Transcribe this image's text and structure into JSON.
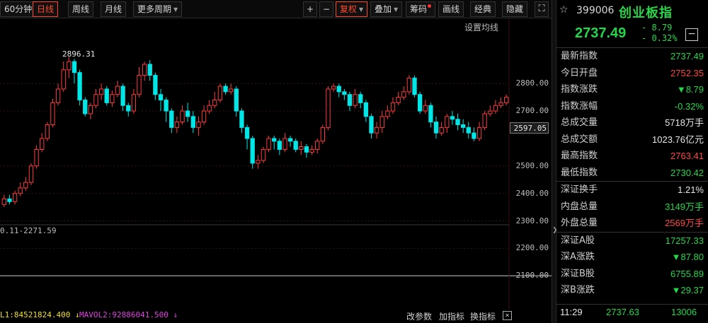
{
  "toolbar": {
    "items": [
      {
        "label": "60分钟",
        "active": false
      },
      {
        "label": "日线",
        "active": true
      },
      {
        "label": "周线",
        "active": false
      },
      {
        "label": "月线",
        "active": false
      },
      {
        "label": "更多周期",
        "active": false
      }
    ],
    "zoom_in": "+",
    "zoom_out": "−",
    "fuquan": "复权",
    "diejia": "叠加",
    "chouma": "筹码",
    "huaxian": "画线",
    "jingdian": "经典",
    "yincang": "隐藏",
    "fullscreen": "⛶"
  },
  "chart": {
    "set_ma_label": "设置均线",
    "price_ticks": [
      {
        "value": "2800.00",
        "y": 2800
      },
      {
        "value": "2700.00",
        "y": 2700
      },
      {
        "value": "2500.00",
        "y": 2500
      },
      {
        "value": "2400.00",
        "y": 2400
      },
      {
        "value": "2300.00",
        "y": 2300
      },
      {
        "value": "2200.00",
        "y": 2200
      },
      {
        "value": "2100.00",
        "y": 2100
      }
    ],
    "current_tag": "2597.05",
    "high_marker": "2896.31",
    "low_marker": "0.11-2271.59",
    "vol1": "L1:84521824.400 ↓",
    "vol2": "MAVOL2:92886041.500 ↓",
    "vol_buttons": [
      "改参数",
      "加指标",
      "换指标"
    ],
    "vol_close": "×",
    "colors": {
      "up": "#ff3b3b",
      "down": "#00e5e5",
      "grid": "#3a1010"
    }
  },
  "chart_data": {
    "type": "candlestick",
    "ylim": [
      2080,
      2960
    ],
    "candles": [
      [
        2360,
        2380,
        2395,
        2350
      ],
      [
        2380,
        2370,
        2395,
        2360
      ],
      [
        2370,
        2400,
        2410,
        2360
      ],
      [
        2400,
        2420,
        2440,
        2390
      ],
      [
        2420,
        2440,
        2460,
        2410
      ],
      [
        2440,
        2500,
        2510,
        2430
      ],
      [
        2500,
        2560,
        2575,
        2490
      ],
      [
        2560,
        2600,
        2620,
        2550
      ],
      [
        2600,
        2650,
        2660,
        2590
      ],
      [
        2650,
        2730,
        2745,
        2640
      ],
      [
        2730,
        2780,
        2800,
        2720
      ],
      [
        2780,
        2850,
        2880,
        2770
      ],
      [
        2850,
        2880,
        2896,
        2820
      ],
      [
        2880,
        2840,
        2890,
        2800
      ],
      [
        2840,
        2740,
        2850,
        2720
      ],
      [
        2740,
        2690,
        2750,
        2680
      ],
      [
        2690,
        2720,
        2730,
        2670
      ],
      [
        2720,
        2760,
        2780,
        2710
      ],
      [
        2760,
        2780,
        2800,
        2740
      ],
      [
        2780,
        2730,
        2790,
        2720
      ],
      [
        2730,
        2760,
        2775,
        2715
      ],
      [
        2760,
        2790,
        2810,
        2750
      ],
      [
        2790,
        2720,
        2800,
        2700
      ],
      [
        2720,
        2700,
        2730,
        2680
      ],
      [
        2700,
        2760,
        2780,
        2690
      ],
      [
        2760,
        2830,
        2860,
        2750
      ],
      [
        2830,
        2870,
        2880,
        2810
      ],
      [
        2870,
        2830,
        2885,
        2810
      ],
      [
        2830,
        2760,
        2840,
        2740
      ],
      [
        2760,
        2740,
        2780,
        2700
      ],
      [
        2740,
        2700,
        2750,
        2660
      ],
      [
        2700,
        2640,
        2710,
        2620
      ],
      [
        2640,
        2660,
        2680,
        2620
      ],
      [
        2660,
        2700,
        2720,
        2650
      ],
      [
        2700,
        2680,
        2730,
        2660
      ],
      [
        2680,
        2640,
        2700,
        2620
      ],
      [
        2640,
        2660,
        2680,
        2610
      ],
      [
        2660,
        2700,
        2720,
        2650
      ],
      [
        2700,
        2720,
        2740,
        2690
      ],
      [
        2720,
        2740,
        2770,
        2710
      ],
      [
        2740,
        2790,
        2800,
        2730
      ],
      [
        2790,
        2770,
        2800,
        2760
      ],
      [
        2770,
        2780,
        2800,
        2760
      ],
      [
        2780,
        2700,
        2790,
        2680
      ],
      [
        2700,
        2640,
        2710,
        2620
      ],
      [
        2640,
        2600,
        2650,
        2560
      ],
      [
        2600,
        2510,
        2610,
        2490
      ],
      [
        2510,
        2520,
        2540,
        2490
      ],
      [
        2520,
        2560,
        2570,
        2510
      ],
      [
        2560,
        2600,
        2610,
        2550
      ],
      [
        2600,
        2590,
        2610,
        2560
      ],
      [
        2590,
        2560,
        2600,
        2540
      ],
      [
        2560,
        2600,
        2620,
        2550
      ],
      [
        2600,
        2590,
        2610,
        2570
      ],
      [
        2590,
        2560,
        2600,
        2550
      ],
      [
        2560,
        2570,
        2590,
        2540
      ],
      [
        2570,
        2550,
        2580,
        2530
      ],
      [
        2550,
        2560,
        2575,
        2540
      ],
      [
        2560,
        2590,
        2600,
        2545
      ],
      [
        2590,
        2640,
        2650,
        2580
      ],
      [
        2640,
        2780,
        2790,
        2630
      ],
      [
        2780,
        2790,
        2800,
        2770
      ],
      [
        2790,
        2770,
        2800,
        2750
      ],
      [
        2770,
        2760,
        2780,
        2740
      ],
      [
        2760,
        2720,
        2770,
        2700
      ],
      [
        2720,
        2760,
        2780,
        2710
      ],
      [
        2760,
        2730,
        2770,
        2710
      ],
      [
        2730,
        2680,
        2740,
        2660
      ],
      [
        2680,
        2620,
        2690,
        2600
      ],
      [
        2620,
        2640,
        2660,
        2600
      ],
      [
        2640,
        2680,
        2700,
        2620
      ],
      [
        2680,
        2700,
        2720,
        2670
      ],
      [
        2700,
        2730,
        2750,
        2690
      ],
      [
        2730,
        2750,
        2770,
        2720
      ],
      [
        2750,
        2770,
        2790,
        2740
      ],
      [
        2770,
        2820,
        2830,
        2760
      ],
      [
        2820,
        2760,
        2830,
        2750
      ],
      [
        2760,
        2700,
        2770,
        2690
      ],
      [
        2700,
        2720,
        2740,
        2690
      ],
      [
        2720,
        2660,
        2730,
        2640
      ],
      [
        2660,
        2620,
        2680,
        2600
      ],
      [
        2620,
        2640,
        2660,
        2610
      ],
      [
        2640,
        2680,
        2690,
        2620
      ],
      [
        2680,
        2670,
        2700,
        2650
      ],
      [
        2670,
        2650,
        2690,
        2630
      ],
      [
        2650,
        2640,
        2670,
        2620
      ],
      [
        2640,
        2620,
        2660,
        2600
      ],
      [
        2620,
        2600,
        2640,
        2590
      ],
      [
        2600,
        2640,
        2660,
        2590
      ],
      [
        2640,
        2690,
        2700,
        2630
      ],
      [
        2690,
        2700,
        2720,
        2680
      ],
      [
        2700,
        2720,
        2740,
        2690
      ],
      [
        2720,
        2730,
        2750,
        2710
      ],
      [
        2730,
        2750,
        2760,
        2720
      ]
    ]
  },
  "panel": {
    "star": "☆",
    "code": "399006",
    "name": "创业板指",
    "price": "2737.49",
    "change": "- 8.79",
    "change_pct": "- 0.32%",
    "minimize": "−",
    "rows_a": [
      {
        "k": "最新指数",
        "v": "2737.49",
        "cls": "down"
      },
      {
        "k": "今日开盘",
        "v": "2752.35",
        "cls": "up"
      },
      {
        "k": "指数涨跌",
        "v": "▼8.79",
        "cls": "down"
      },
      {
        "k": "指数涨幅",
        "v": "-0.32%",
        "cls": "down"
      },
      {
        "k": "总成交量",
        "v": "5718万手",
        "cls": "white"
      },
      {
        "k": "总成交额",
        "v": "1023.76亿元",
        "cls": "white"
      },
      {
        "k": "最高指数",
        "v": "2763.41",
        "cls": "up"
      },
      {
        "k": "最低指数",
        "v": "2730.42",
        "cls": "down"
      }
    ],
    "rows_b": [
      {
        "k": "深证换手",
        "v": "1.21%",
        "cls": "white"
      },
      {
        "k": "内盘总量",
        "v": "3149万手",
        "cls": "down"
      },
      {
        "k": "外盘总量",
        "v": "2569万手",
        "cls": "up"
      }
    ],
    "rows_c": [
      {
        "k": "深证A股",
        "v": "17257.33",
        "cls": "down"
      },
      {
        "k": "深A涨跌",
        "v": "▼87.80",
        "cls": "down"
      },
      {
        "k": "深证B股",
        "v": "6755.89",
        "cls": "down"
      },
      {
        "k": "深B涨跌",
        "v": "▼29.37",
        "cls": "down"
      }
    ],
    "tick": {
      "time": "11:29",
      "price": "2737.63",
      "vol": "13006"
    }
  }
}
